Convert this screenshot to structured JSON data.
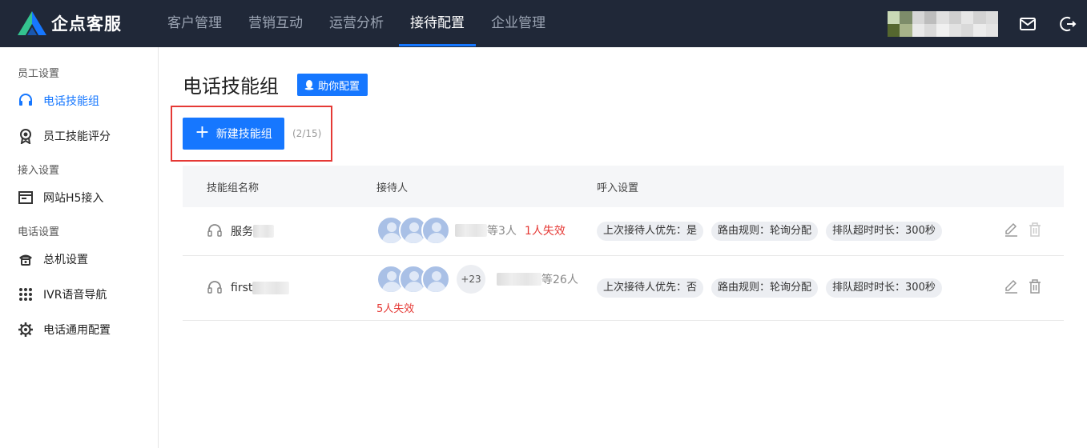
{
  "app": {
    "name": "企点客服"
  },
  "nav": [
    {
      "label": "客户管理",
      "active": false
    },
    {
      "label": "营销互动",
      "active": false
    },
    {
      "label": "运营分析",
      "active": false
    },
    {
      "label": "接待配置",
      "active": true
    },
    {
      "label": "企业管理",
      "active": false
    }
  ],
  "topbar_icons": [
    "mail-icon",
    "logout-icon"
  ],
  "sidebar": {
    "groups": [
      {
        "title": "员工设置",
        "items": [
          {
            "label": "电话技能组",
            "icon": "headset-icon",
            "active": true
          },
          {
            "label": "员工技能评分",
            "icon": "award-icon",
            "active": false
          }
        ]
      },
      {
        "title": "接入设置",
        "items": [
          {
            "label": "网站H5接入",
            "icon": "web-window-icon",
            "active": false
          }
        ]
      },
      {
        "title": "电话设置",
        "items": [
          {
            "label": "总机设置",
            "icon": "telephone-icon",
            "active": false
          },
          {
            "label": "IVR语音导航",
            "icon": "dialpad-icon",
            "active": false
          },
          {
            "label": "电话通用配置",
            "icon": "settings-gear-icon",
            "active": false
          }
        ]
      }
    ]
  },
  "main": {
    "title": "电话技能组",
    "help_button": "助你配置",
    "new_button": "新建技能组",
    "count": "(2/15)",
    "table": {
      "headers": [
        "技能组名称",
        "接待人",
        "呼入设置"
      ],
      "rows": [
        {
          "name": "服务",
          "receivers_suffix": "等3人",
          "extra_count": "",
          "invalid": "1人失效",
          "settings": [
            "上次接待人优先：是",
            "路由规则：轮询分配",
            "排队超时时长：300秒"
          ]
        },
        {
          "name": "first",
          "receivers_suffix": "等26人",
          "extra_count": "+23",
          "invalid": "5人失效",
          "settings": [
            "上次接待人优先：否",
            "路由规则：轮询分配",
            "排队超时时长：300秒"
          ]
        }
      ]
    }
  },
  "colors": {
    "topbar": "#202838",
    "accent": "#1677ff",
    "danger": "#e53935",
    "highlight_border": "#e53935"
  }
}
